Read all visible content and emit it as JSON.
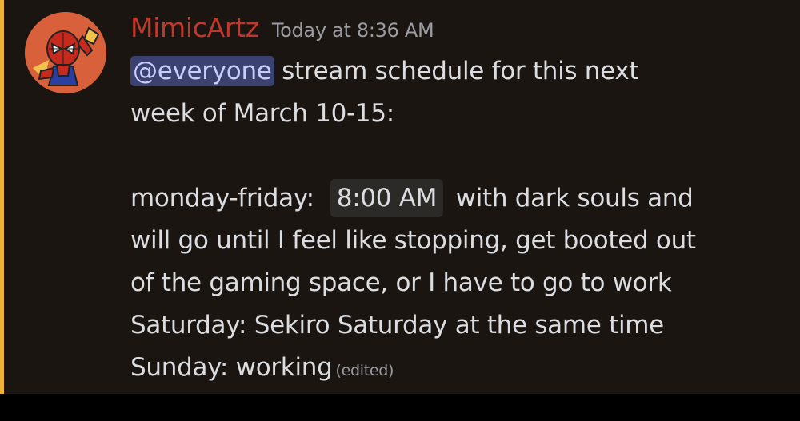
{
  "message": {
    "username": "MimicArtz",
    "timestamp": "Today at 8:36 AM",
    "mention": "@everyone",
    "line1_rest": " stream schedule for this next",
    "line2": "week of March 10-15:",
    "line3_prefix": "monday-friday:",
    "time_chip": "8:00 AM",
    "line3_suffix": " with dark souls and",
    "line4": "will go until I feel like stopping, get booted out",
    "line5": "of the gaming space, or I have to go to work",
    "line6": "Saturday: Sekiro Saturday at the same time",
    "line7": "Sunday: working",
    "edited_label": "(edited)"
  },
  "colors": {
    "background": "#1a1510",
    "mention_bar": "#f0b232",
    "username": "#c0372c",
    "mention_bg": "#3c4270"
  },
  "avatar": {
    "icon": "spider-man-avatar-icon"
  }
}
